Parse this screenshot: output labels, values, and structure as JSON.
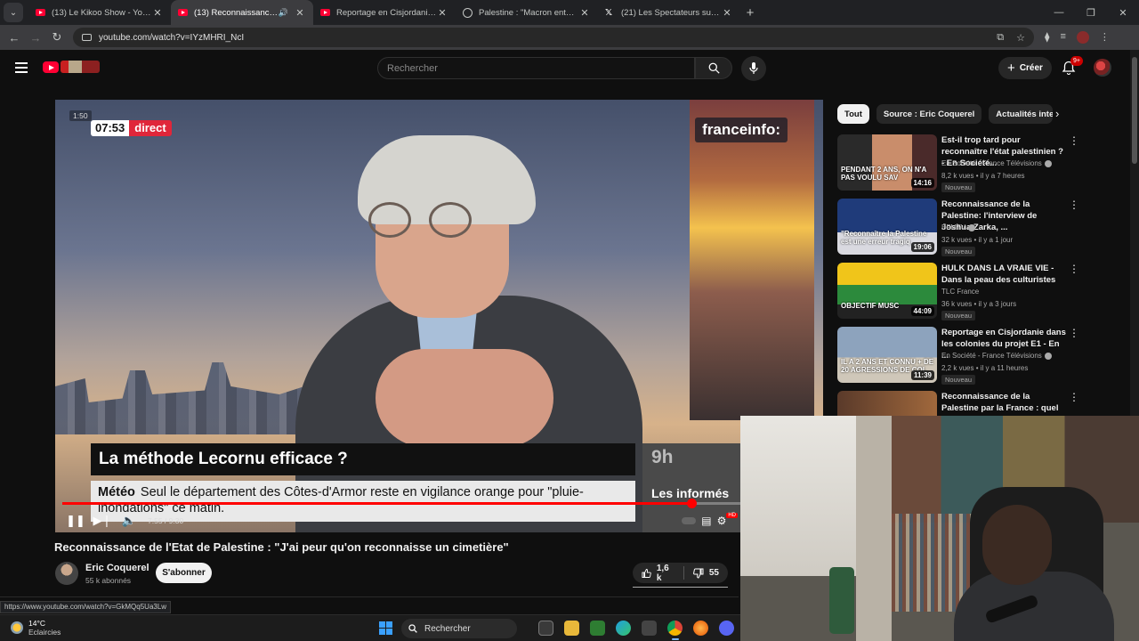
{
  "browser": {
    "tabs": [
      {
        "title": "(13) Le Kikoo Show - YouTube",
        "icon": "youtube-icon",
        "active": false
      },
      {
        "title": "(13) Reconnaissance de l'Etat",
        "icon": "youtube-icon",
        "active": true
      },
      {
        "title": "Reportage en Cisjordanie dans",
        "icon": "youtube-icon",
        "active": false
      },
      {
        "title": "Palestine : \"Macron entérine ce",
        "icon": "globe-icon",
        "active": false
      },
      {
        "title": "(21) Les Spectateurs sur X : \"",
        "icon": "x-icon",
        "active": false
      }
    ],
    "url": "youtube.com/watch?v=IYzMHRI_NcI",
    "status_url": "https://www.youtube.com/watch?v=GkMQq5Ua3Lw"
  },
  "youtube": {
    "search_placeholder": "Rechercher",
    "create_label": "Créer",
    "notifications_badge": "9+"
  },
  "player": {
    "overlay_time_small": "1:50",
    "clock": "07:53",
    "live_label": "direct",
    "channel_logo": "franceinfo:",
    "headline": "La méthode Lecornu efficace ?",
    "ticker_label": "Météo",
    "ticker_text": "Seul le département des Côtes-d'Armor reste en vigilance orange pour \"pluie-inondations\" ce matin.",
    "program_hour": "9h",
    "program_name": "Les informés",
    "time_display": "7:55 / 9:30",
    "progress": 0.835
  },
  "video": {
    "title": "Reconnaissance de l'Etat de Palestine : \"J'ai peur qu'on reconnaisse un cimetière\"",
    "channel": "Eric Coquerel",
    "subscribers": "55 k abonnés",
    "subscribe_label": "S'abonner",
    "likes": "1,6 k",
    "dislikes": "55"
  },
  "sidebar": {
    "chips": [
      "Tout",
      "Source : Eric Coquerel",
      "Actualités interna"
    ],
    "recommendations": [
      {
        "title": "Est-il trop tard pour reconnaître l'état palestinien ? - En Société...",
        "channel": "En Société - France Télévisions",
        "meta": "8,2 k vues • il y a 7 heures",
        "badge": "Nouveau",
        "duration": "14:16",
        "overlay": "PENDANT 2 ANS, ON N'A PAS VOULU SAV"
      },
      {
        "title": "Reconnaissance de la Palestine: l'interview de Joshua Zarka, ...",
        "channel": "BFMTV",
        "meta": "32 k vues • il y a 1 jour",
        "badge": "Nouveau",
        "duration": "19:06",
        "overlay": "\"Reconnaître la Palestine est une erreur tragiq"
      },
      {
        "title": "HULK DANS LA VRAIE VIE - Dans la peau des culturistes",
        "channel": "TLC France",
        "meta": "36 k vues • il y a 3 jours",
        "badge": "Nouveau",
        "duration": "44:09",
        "overlay": "OBJECTIF MUSC"
      },
      {
        "title": "Reportage en Cisjordanie dans les colonies du projet E1 - En ...",
        "channel": "En Société - France Télévisions",
        "meta": "2,2 k vues • il y a 11 heures",
        "badge": "Nouveau",
        "duration": "11:39",
        "overlay": "IL A 2 ANS ET CONNU + DE 20 AGRESSIONS DE COL"
      },
      {
        "title": "Reconnaissance de la Palestine par la France : quel impact pou...",
        "channel": "",
        "meta": "",
        "badge": "",
        "duration": "",
        "overlay": ""
      }
    ]
  },
  "taskbar": {
    "temperature": "14°C",
    "condition": "Eclaircies",
    "search_label": "Rechercher"
  },
  "colors": {
    "accent": "#ff0033",
    "live_red": "#e0263a",
    "background": "#0f0f0f"
  }
}
